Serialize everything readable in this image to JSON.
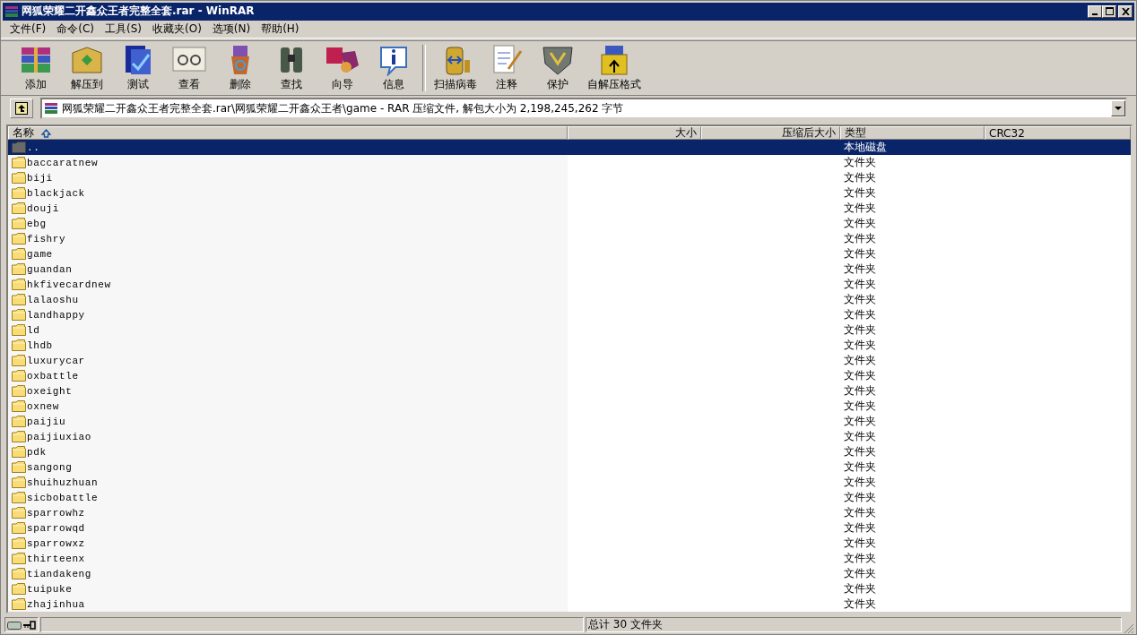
{
  "window": {
    "title": "网狐荣耀二开鑫众王者完整全套.rar - WinRAR"
  },
  "menu": [
    {
      "label": "文件(F)"
    },
    {
      "label": "命令(C)"
    },
    {
      "label": "工具(S)"
    },
    {
      "label": "收藏夹(O)"
    },
    {
      "label": "选项(N)"
    },
    {
      "label": "帮助(H)"
    }
  ],
  "toolbar": [
    {
      "label": "添加"
    },
    {
      "label": "解压到"
    },
    {
      "label": "测试"
    },
    {
      "label": "查看"
    },
    {
      "label": "删除"
    },
    {
      "label": "查找"
    },
    {
      "label": "向导"
    },
    {
      "label": "信息"
    },
    {
      "label": "扫描病毒"
    },
    {
      "label": "注释"
    },
    {
      "label": "保护"
    },
    {
      "label": "自解压格式"
    }
  ],
  "address": {
    "path": "网狐荣耀二开鑫众王者完整全套.rar\\网狐荣耀二开鑫众王者\\game - RAR 压缩文件, 解包大小为 2,198,245,262 字节"
  },
  "table": {
    "columns": [
      {
        "label": "名称",
        "sorted": true
      },
      {
        "label": "大小",
        "sorted": false
      },
      {
        "label": "压缩后大小",
        "sorted": false
      },
      {
        "label": "类型",
        "sorted": false
      },
      {
        "label": "CRC32",
        "sorted": false
      }
    ],
    "rows": [
      {
        "name": "..",
        "type": "本地磁盘",
        "kind": "parent",
        "selected": true
      },
      {
        "name": "baccaratnew",
        "type": "文件夹",
        "kind": "folder",
        "selected": false
      },
      {
        "name": "biji",
        "type": "文件夹",
        "kind": "folder",
        "selected": false
      },
      {
        "name": "blackjack",
        "type": "文件夹",
        "kind": "folder",
        "selected": false
      },
      {
        "name": "douji",
        "type": "文件夹",
        "kind": "folder",
        "selected": false
      },
      {
        "name": "ebg",
        "type": "文件夹",
        "kind": "folder",
        "selected": false
      },
      {
        "name": "fishry",
        "type": "文件夹",
        "kind": "folder",
        "selected": false
      },
      {
        "name": "game",
        "type": "文件夹",
        "kind": "folder",
        "selected": false
      },
      {
        "name": "guandan",
        "type": "文件夹",
        "kind": "folder",
        "selected": false
      },
      {
        "name": "hkfivecardnew",
        "type": "文件夹",
        "kind": "folder",
        "selected": false
      },
      {
        "name": "lalaoshu",
        "type": "文件夹",
        "kind": "folder",
        "selected": false
      },
      {
        "name": "landhappy",
        "type": "文件夹",
        "kind": "folder",
        "selected": false
      },
      {
        "name": "ld",
        "type": "文件夹",
        "kind": "folder",
        "selected": false
      },
      {
        "name": "lhdb",
        "type": "文件夹",
        "kind": "folder",
        "selected": false
      },
      {
        "name": "luxurycar",
        "type": "文件夹",
        "kind": "folder",
        "selected": false
      },
      {
        "name": "oxbattle",
        "type": "文件夹",
        "kind": "folder",
        "selected": false
      },
      {
        "name": "oxeight",
        "type": "文件夹",
        "kind": "folder",
        "selected": false
      },
      {
        "name": "oxnew",
        "type": "文件夹",
        "kind": "folder",
        "selected": false
      },
      {
        "name": "paijiu",
        "type": "文件夹",
        "kind": "folder",
        "selected": false
      },
      {
        "name": "paijiuxiao",
        "type": "文件夹",
        "kind": "folder",
        "selected": false
      },
      {
        "name": "pdk",
        "type": "文件夹",
        "kind": "folder",
        "selected": false
      },
      {
        "name": "sangong",
        "type": "文件夹",
        "kind": "folder",
        "selected": false
      },
      {
        "name": "shuihuzhuan",
        "type": "文件夹",
        "kind": "folder",
        "selected": false
      },
      {
        "name": "sicbobattle",
        "type": "文件夹",
        "kind": "folder",
        "selected": false
      },
      {
        "name": "sparrowhz",
        "type": "文件夹",
        "kind": "folder",
        "selected": false
      },
      {
        "name": "sparrowqd",
        "type": "文件夹",
        "kind": "folder",
        "selected": false
      },
      {
        "name": "sparrowxz",
        "type": "文件夹",
        "kind": "folder",
        "selected": false
      },
      {
        "name": "thirteenx",
        "type": "文件夹",
        "kind": "folder",
        "selected": false
      },
      {
        "name": "tiandakeng",
        "type": "文件夹",
        "kind": "folder",
        "selected": false
      },
      {
        "name": "tuipuke",
        "type": "文件夹",
        "kind": "folder",
        "selected": false
      },
      {
        "name": "zhajinhua",
        "type": "文件夹",
        "kind": "folder",
        "selected": false
      }
    ]
  },
  "status_bar": {
    "text": "总计 30 文件夹"
  }
}
